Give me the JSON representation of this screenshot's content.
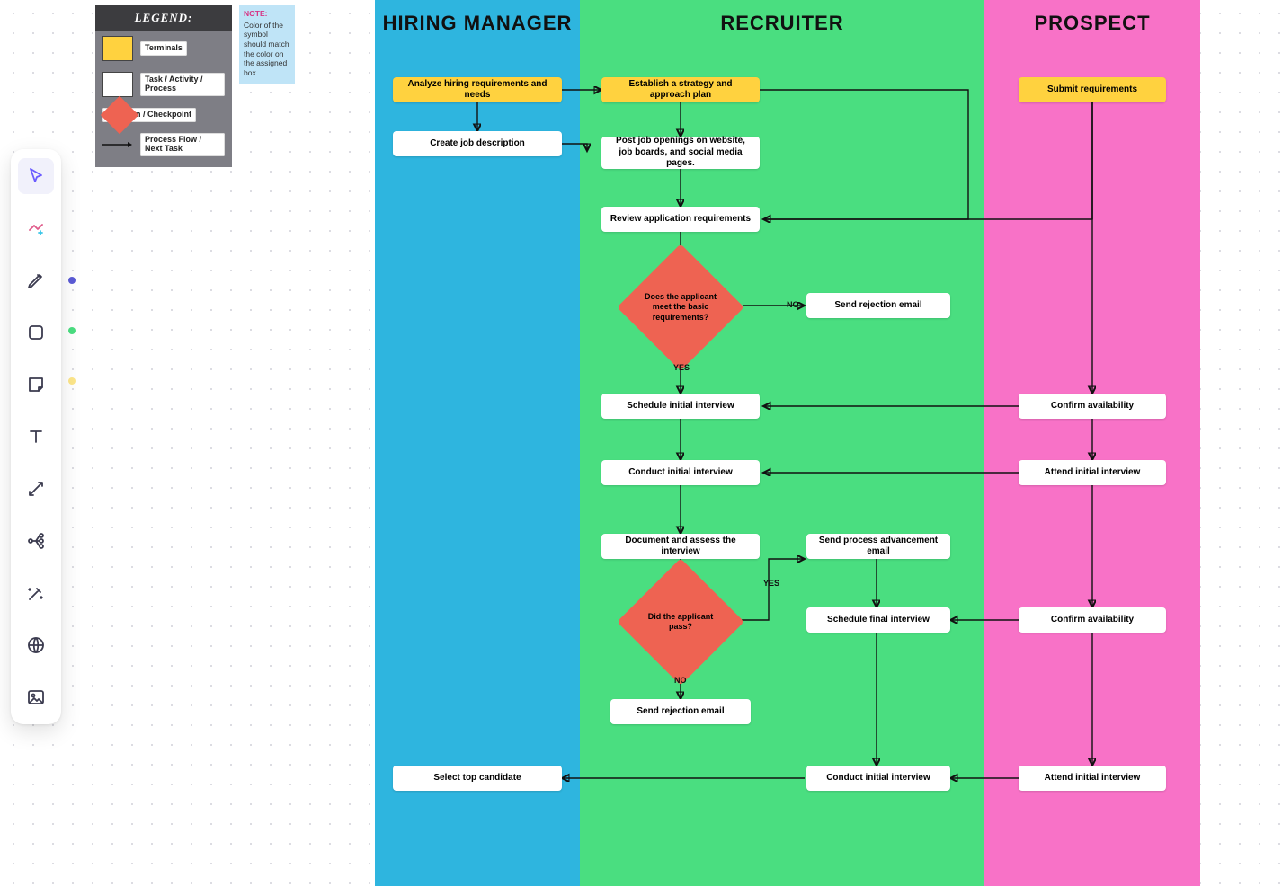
{
  "legend": {
    "title": "LEGEND:",
    "items": [
      {
        "label": "Terminals"
      },
      {
        "label": "Task / Activity / Process"
      },
      {
        "label": "Decision / Checkpoint"
      },
      {
        "label": "Process Flow / Next Task"
      }
    ]
  },
  "note": {
    "title": "NOTE:",
    "body": "Color of the symbol should match the color on the assigned box"
  },
  "lanes": {
    "hiring_manager": "HIRING MANAGER",
    "recruiter": "RECRUITER",
    "prospect": "PROSPECT"
  },
  "nodes": {
    "hm_analyze": "Analyze hiring requirements and needs",
    "hm_jobdesc": "Create job description",
    "hm_select": "Select top candidate",
    "rc_strategy": "Establish a strategy and approach plan",
    "rc_post": "Post job openings on website, job boards, and social media pages.",
    "rc_review": "Review application requirements",
    "rc_decide1": "Does the applicant meet the basic requirements?",
    "rc_reject1": "Send rejection email",
    "rc_sched1": "Schedule initial interview",
    "rc_conduct1": "Conduct initial interview",
    "rc_assess": "Document and assess the interview",
    "rc_decide2": "Did the applicant pass?",
    "rc_advance": "Send process advancement email",
    "rc_schedfinal": "Schedule final interview",
    "rc_reject2": "Send rejection email",
    "rc_conductfinal": "Conduct initial interview",
    "pr_submit": "Submit requirements",
    "pr_confirm1": "Confirm availability",
    "pr_attend1": "Attend initial interview",
    "pr_confirm2": "Confirm availability",
    "pr_attend2": "Attend initial interview"
  },
  "edge_labels": {
    "yes1": "YES",
    "no1": "NO",
    "yes2": "YES",
    "no2": "NO"
  },
  "tools": [
    "select",
    "ai",
    "draw",
    "shape",
    "sticky",
    "text",
    "connector",
    "mindmap",
    "magic",
    "embed",
    "image"
  ],
  "tool_colors": {
    "draw": "#5b5bd6",
    "shape": "#4ade80",
    "sticky": "#fef3c7"
  }
}
